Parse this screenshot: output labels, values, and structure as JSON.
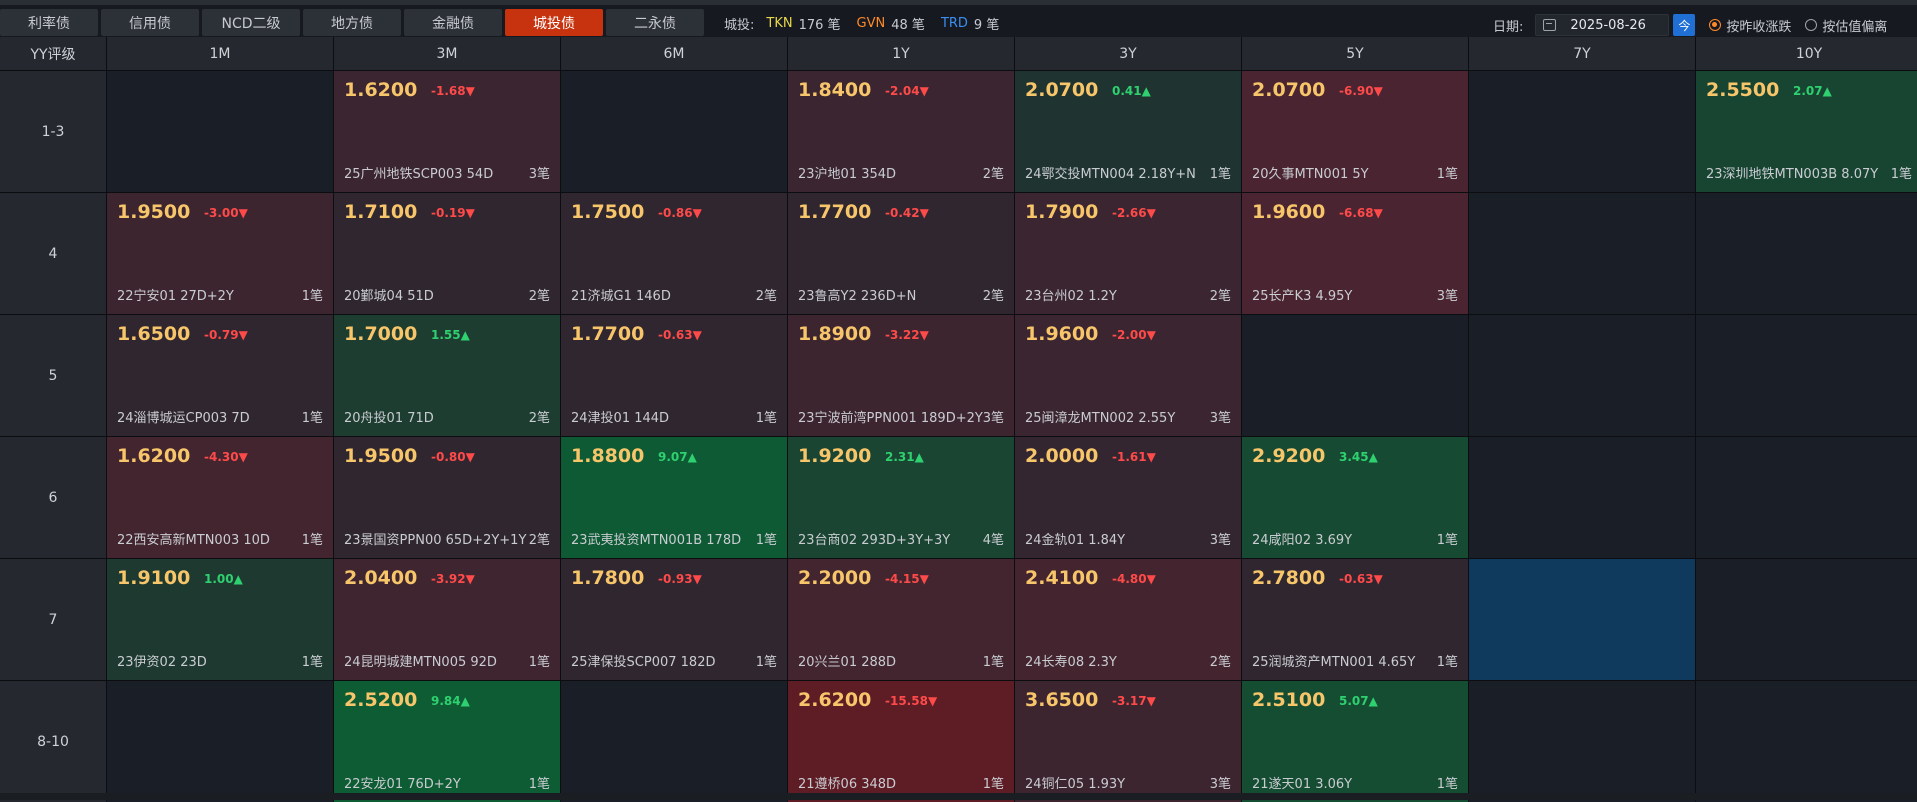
{
  "tabs": [
    {
      "label": "利率债",
      "active": false
    },
    {
      "label": "信用债",
      "active": false
    },
    {
      "label": "NCD二级",
      "active": false
    },
    {
      "label": "地方债",
      "active": false
    },
    {
      "label": "金融债",
      "active": false
    },
    {
      "label": "城投债",
      "active": true
    },
    {
      "label": "二永债",
      "active": false
    }
  ],
  "summary": {
    "label": "城投:",
    "tkn": {
      "tag": "TKN",
      "count": "176 笔",
      "color": "#e8d84a"
    },
    "gvn": {
      "tag": "GVN",
      "count": "48 笔",
      "color": "#ff8a28"
    },
    "trd": {
      "tag": "TRD",
      "count": "9 笔",
      "color": "#3a8ff0"
    }
  },
  "date": {
    "label": "日期:",
    "value": "2025-08-26",
    "today_btn": "今"
  },
  "mode": {
    "options": [
      "按昨收涨跌",
      "按估值偏离"
    ],
    "selected": 0
  },
  "colors": {
    "up_color": "#2fd070",
    "down_color": "#ff4a4a",
    "yield_color": "#f7c56a",
    "active_tab": "#c8330f"
  },
  "table": {
    "corner": "YY评级",
    "columns": [
      "1M",
      "3M",
      "6M",
      "1Y",
      "3Y",
      "5Y",
      "7Y",
      "10Y"
    ],
    "rows": [
      {
        "label": "1-3",
        "cells": [
          null,
          {
            "yield": "1.6200",
            "change": "-1.68",
            "dir": "down",
            "bond": "25广州地铁SCP003 54D",
            "count": "3笔",
            "bg": "#3a2530"
          },
          null,
          {
            "yield": "1.8400",
            "change": "-2.04",
            "dir": "down",
            "bond": "23沪地01 354D",
            "count": "2笔",
            "bg": "#3a2530"
          },
          {
            "yield": "2.0700",
            "change": "0.41",
            "dir": "up",
            "bond": "24鄂交投MTN004 2.18Y+N",
            "count": "1笔",
            "bg": "#1f3430"
          },
          {
            "yield": "2.0700",
            "change": "-6.90",
            "dir": "down",
            "bond": "20久事MTN001 5Y",
            "count": "1笔",
            "bg": "#4a2430"
          },
          null,
          {
            "yield": "2.5500",
            "change": "2.07",
            "dir": "up",
            "bond": "23深圳地铁MTN003B 8.07Y",
            "count": "1笔",
            "bg": "#184532"
          }
        ]
      },
      {
        "label": "4",
        "cells": [
          {
            "yield": "1.9500",
            "change": "-3.00",
            "dir": "down",
            "bond": "22宁安01 27D+2Y",
            "count": "1笔",
            "bg": "#3d2530"
          },
          {
            "yield": "1.7100",
            "change": "-0.19",
            "dir": "down",
            "bond": "20鄞城04 51D",
            "count": "2笔",
            "bg": "#2f2630"
          },
          {
            "yield": "1.7500",
            "change": "-0.86",
            "dir": "down",
            "bond": "21济城G1 146D",
            "count": "2笔",
            "bg": "#30262f"
          },
          {
            "yield": "1.7700",
            "change": "-0.42",
            "dir": "down",
            "bond": "23鲁高Y2 236D+N",
            "count": "2笔",
            "bg": "#30262f"
          },
          {
            "yield": "1.7900",
            "change": "-2.66",
            "dir": "down",
            "bond": "23台州02 1.2Y",
            "count": "2笔",
            "bg": "#3a2530"
          },
          {
            "yield": "1.9600",
            "change": "-6.68",
            "dir": "down",
            "bond": "25长产K3 4.95Y",
            "count": "3笔",
            "bg": "#4a2430"
          },
          null,
          null
        ]
      },
      {
        "label": "5",
        "cells": [
          {
            "yield": "1.6500",
            "change": "-0.79",
            "dir": "down",
            "bond": "24淄博城运CP003 7D",
            "count": "1笔",
            "bg": "#30262f"
          },
          {
            "yield": "1.7000",
            "change": "1.55",
            "dir": "up",
            "bond": "20舟投01 71D",
            "count": "2笔",
            "bg": "#1d3d30"
          },
          {
            "yield": "1.7700",
            "change": "-0.63",
            "dir": "down",
            "bond": "24津投01 144D",
            "count": "1笔",
            "bg": "#30262f"
          },
          {
            "yield": "1.8900",
            "change": "-3.22",
            "dir": "down",
            "bond": "23宁波前湾PPN001 189D+2Y",
            "count": "3笔",
            "bg": "#3d2530"
          },
          {
            "yield": "1.9600",
            "change": "-2.00",
            "dir": "down",
            "bond": "25闽漳龙MTN002 2.55Y",
            "count": "3笔",
            "bg": "#3a2530"
          },
          null,
          null,
          null
        ]
      },
      {
        "label": "6",
        "cells": [
          {
            "yield": "1.6200",
            "change": "-4.30",
            "dir": "down",
            "bond": "22西安高新MTN003 10D",
            "count": "1笔",
            "bg": "#42252f"
          },
          {
            "yield": "1.9500",
            "change": "-0.80",
            "dir": "down",
            "bond": "23景国资PPN00 65D+2Y+1Y",
            "count": "2笔",
            "bg": "#30262f"
          },
          {
            "yield": "1.8800",
            "change": "9.07",
            "dir": "up",
            "bond": "23武夷投资MTN001B 178D",
            "count": "1笔",
            "bg": "#0e5a34"
          },
          {
            "yield": "1.9200",
            "change": "2.31",
            "dir": "up",
            "bond": "23台商02 293D+3Y+3Y",
            "count": "4笔",
            "bg": "#194532"
          },
          {
            "yield": "2.0000",
            "change": "-1.61",
            "dir": "down",
            "bond": "24金轨01 1.84Y",
            "count": "3笔",
            "bg": "#332630"
          },
          {
            "yield": "2.9200",
            "change": "3.45",
            "dir": "up",
            "bond": "24咸阳02 3.69Y",
            "count": "1笔",
            "bg": "#174a33"
          },
          null,
          null
        ]
      },
      {
        "label": "7",
        "cells": [
          {
            "yield": "1.9100",
            "change": "1.00",
            "dir": "up",
            "bond": "23伊资02 23D",
            "count": "1笔",
            "bg": "#1e3a30"
          },
          {
            "yield": "2.0400",
            "change": "-3.92",
            "dir": "down",
            "bond": "24昆明城建MTN005 92D",
            "count": "1笔",
            "bg": "#3f2530"
          },
          {
            "yield": "1.7800",
            "change": "-0.93",
            "dir": "down",
            "bond": "25津保投SCP007 182D",
            "count": "1笔",
            "bg": "#30262f"
          },
          {
            "yield": "2.2000",
            "change": "-4.15",
            "dir": "down",
            "bond": "20兴兰01 288D",
            "count": "1笔",
            "bg": "#42252f"
          },
          {
            "yield": "2.4100",
            "change": "-4.80",
            "dir": "down",
            "bond": "24长寿08 2.3Y",
            "count": "2笔",
            "bg": "#44252f"
          },
          {
            "yield": "2.7800",
            "change": "-0.63",
            "dir": "down",
            "bond": "25润城资产MTN001 4.65Y",
            "count": "1笔",
            "bg": "#30262f"
          },
          {
            "selected": true
          },
          null
        ]
      },
      {
        "label": "8-10",
        "cells": [
          null,
          {
            "yield": "2.5200",
            "change": "9.84",
            "dir": "up",
            "bond": "22安龙01 76D+2Y",
            "count": "1笔",
            "bg": "#0e5c34"
          },
          null,
          {
            "yield": "2.6200",
            "change": "-15.58",
            "dir": "down",
            "bond": "21遵桥06 348D",
            "count": "1笔",
            "bg": "#5e1c25"
          },
          {
            "yield": "3.6500",
            "change": "-3.17",
            "dir": "down",
            "bond": "24铜仁05 1.93Y",
            "count": "3笔",
            "bg": "#3d2530"
          },
          {
            "yield": "2.5100",
            "change": "5.07",
            "dir": "up",
            "bond": "21遂天01 3.06Y",
            "count": "1笔",
            "bg": "#154d33"
          },
          null,
          null
        ]
      }
    ]
  }
}
